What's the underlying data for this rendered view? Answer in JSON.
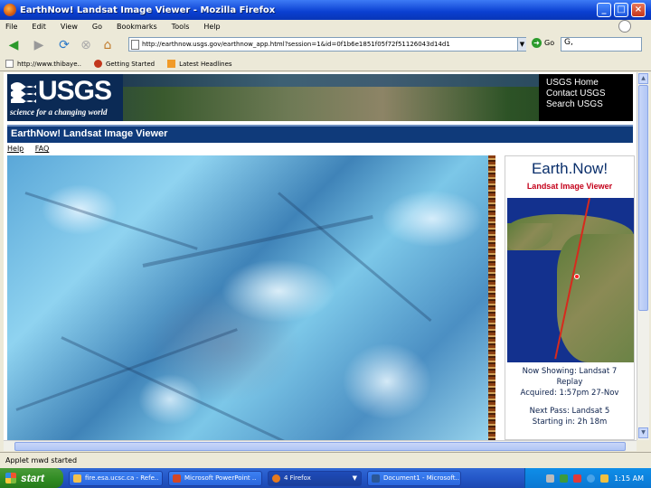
{
  "window": {
    "title": "EarthNow! Landsat Image Viewer - Mozilla Firefox"
  },
  "menu": [
    "File",
    "Edit",
    "View",
    "Go",
    "Bookmarks",
    "Tools",
    "Help"
  ],
  "nav": {
    "url": "http://earthnow.usgs.gov/earthnow_app.html?session=1&id=0f1b6e1851f05f72f51126043d14d1",
    "go_label": "Go",
    "search_placeholder": "G,"
  },
  "bookmarks": [
    "http://www.thibaye..",
    "Getting Started",
    "Latest Headlines"
  ],
  "usgs": {
    "logo_text": "USGS",
    "tagline": "science for a changing world",
    "links": [
      "USGS Home",
      "Contact USGS",
      "Search USGS"
    ]
  },
  "page": {
    "header": "EarthNow! Landsat Image Viewer",
    "help_links": [
      "Help",
      "FAQ"
    ]
  },
  "panel": {
    "title": "Earth.Now!",
    "subtitle": "Landsat Image Viewer",
    "now_showing": "Now Showing: Landsat 7",
    "mode": "Replay",
    "acquired": "Acquired: 1:57pm 27-Nov",
    "next_pass": "Next Pass: Landsat 5",
    "starting": "Starting in: 2h 18m"
  },
  "status": "Applet mwd started",
  "taskbar": {
    "start": "start",
    "tasks": [
      "fire.esa.ucsc.ca - Refe..",
      "Microsoft PowerPoint ..",
      "4 Firefox",
      "Document1 - Microsoft.."
    ],
    "clock": "1:15 AM"
  }
}
